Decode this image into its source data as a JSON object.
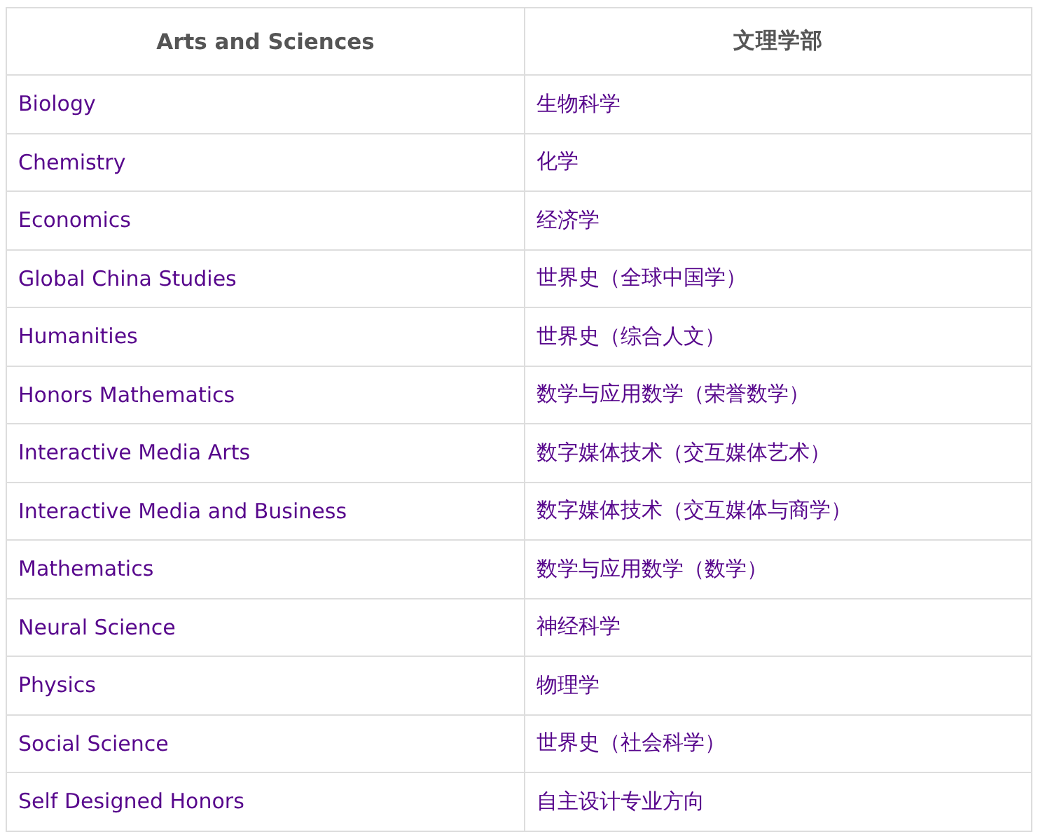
{
  "table": {
    "columns": [
      "Arts and Sciences",
      "文理学部"
    ],
    "rows": [
      [
        "Biology",
        "生物科学"
      ],
      [
        "Chemistry",
        "化学"
      ],
      [
        "Economics",
        "经济学"
      ],
      [
        "Global China Studies",
        "世界史（全球中国学）"
      ],
      [
        "Humanities",
        "世界史（综合人文）"
      ],
      [
        "Honors Mathematics",
        "数学与应用数学（荣誉数学）"
      ],
      [
        "Interactive Media Arts",
        "数字媒体技术（交互媒体艺术）"
      ],
      [
        "Interactive Media and Business",
        "数字媒体技术（交互媒体与商学）"
      ],
      [
        "Mathematics",
        "数学与应用数学（数学）"
      ],
      [
        "Neural Science",
        "神经科学"
      ],
      [
        "Physics",
        "物理学"
      ],
      [
        "Social Science",
        "世界史（社会科学）"
      ],
      [
        "Self Designed Honors",
        "自主设计专业方向"
      ]
    ]
  }
}
